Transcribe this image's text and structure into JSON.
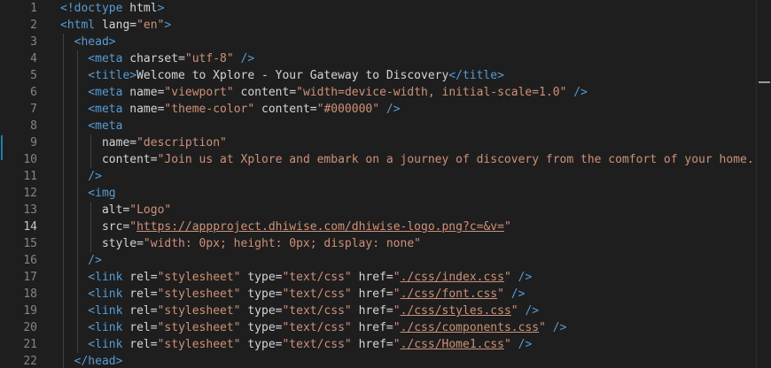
{
  "editor": {
    "active_line": 14,
    "lines": [
      {
        "n": "1",
        "tokens": [
          [
            "tag",
            "<!doctype "
          ],
          [
            "plain",
            "html"
          ],
          [
            "tag",
            ">"
          ]
        ]
      },
      {
        "n": "2",
        "tokens": [
          [
            "tag",
            "<html "
          ],
          [
            "attr",
            "lang"
          ],
          [
            "plain",
            "="
          ],
          [
            "str",
            "\"en\""
          ],
          [
            "tag",
            ">"
          ]
        ]
      },
      {
        "n": "3",
        "tokens": [
          [
            "tag",
            "  <head>"
          ]
        ]
      },
      {
        "n": "4",
        "tokens": [
          [
            "tag",
            "    <meta "
          ],
          [
            "attr",
            "charset"
          ],
          [
            "plain",
            "="
          ],
          [
            "str",
            "\"utf-8\""
          ],
          [
            "tag",
            " />"
          ]
        ]
      },
      {
        "n": "5",
        "tokens": [
          [
            "tag",
            "    <title>"
          ],
          [
            "text",
            "Welcome to Xplore - Your Gateway to Discovery"
          ],
          [
            "tag",
            "</title>"
          ]
        ]
      },
      {
        "n": "6",
        "tokens": [
          [
            "tag",
            "    <meta "
          ],
          [
            "attr",
            "name"
          ],
          [
            "plain",
            "="
          ],
          [
            "str",
            "\"viewport\""
          ],
          [
            "attr",
            " content"
          ],
          [
            "plain",
            "="
          ],
          [
            "str",
            "\"width=device-width, initial-scale=1.0\""
          ],
          [
            "tag",
            " />"
          ]
        ]
      },
      {
        "n": "7",
        "tokens": [
          [
            "tag",
            "    <meta "
          ],
          [
            "attr",
            "name"
          ],
          [
            "plain",
            "="
          ],
          [
            "str",
            "\"theme-color\""
          ],
          [
            "attr",
            " content"
          ],
          [
            "plain",
            "="
          ],
          [
            "str",
            "\"#000000\""
          ],
          [
            "tag",
            " />"
          ]
        ]
      },
      {
        "n": "8",
        "tokens": [
          [
            "tag",
            "    <meta"
          ]
        ]
      },
      {
        "n": "9",
        "tokens": [
          [
            "attr",
            "      name"
          ],
          [
            "plain",
            "="
          ],
          [
            "str",
            "\"description\""
          ]
        ]
      },
      {
        "n": "10",
        "tokens": [
          [
            "attr",
            "      content"
          ],
          [
            "plain",
            "="
          ],
          [
            "str",
            "\"Join us at Xplore and embark on a journey of discovery from the comfort of your home. Exp"
          ]
        ]
      },
      {
        "n": "11",
        "tokens": [
          [
            "tag",
            "    />"
          ]
        ]
      },
      {
        "n": "12",
        "tokens": [
          [
            "tag",
            "    <img"
          ]
        ]
      },
      {
        "n": "13",
        "tokens": [
          [
            "attr",
            "      alt"
          ],
          [
            "plain",
            "="
          ],
          [
            "str",
            "\"Logo\""
          ]
        ]
      },
      {
        "n": "14",
        "tokens": [
          [
            "attr",
            "      src"
          ],
          [
            "plain",
            "="
          ],
          [
            "str",
            "\""
          ],
          [
            "str-link",
            "https://appproject.dhiwise.com/dhiwise-logo.png?c=&v="
          ],
          [
            "str",
            "\""
          ]
        ]
      },
      {
        "n": "15",
        "tokens": [
          [
            "attr",
            "      style"
          ],
          [
            "plain",
            "="
          ],
          [
            "str",
            "\"width: 0px; height: 0px; display: none\""
          ]
        ]
      },
      {
        "n": "16",
        "tokens": [
          [
            "tag",
            "    />"
          ]
        ]
      },
      {
        "n": "17",
        "tokens": [
          [
            "tag",
            "    <link "
          ],
          [
            "attr",
            "rel"
          ],
          [
            "plain",
            "="
          ],
          [
            "str",
            "\"stylesheet\""
          ],
          [
            "attr",
            " type"
          ],
          [
            "plain",
            "="
          ],
          [
            "str",
            "\"text/css\""
          ],
          [
            "attr",
            " href"
          ],
          [
            "plain",
            "="
          ],
          [
            "str",
            "\""
          ],
          [
            "str-link",
            "./css/index.css"
          ],
          [
            "str",
            "\""
          ],
          [
            "tag",
            " />"
          ]
        ]
      },
      {
        "n": "18",
        "tokens": [
          [
            "tag",
            "    <link "
          ],
          [
            "attr",
            "rel"
          ],
          [
            "plain",
            "="
          ],
          [
            "str",
            "\"stylesheet\""
          ],
          [
            "attr",
            " type"
          ],
          [
            "plain",
            "="
          ],
          [
            "str",
            "\"text/css\""
          ],
          [
            "attr",
            " href"
          ],
          [
            "plain",
            "="
          ],
          [
            "str",
            "\""
          ],
          [
            "str-link",
            "./css/font.css"
          ],
          [
            "str",
            "\""
          ],
          [
            "tag",
            " />"
          ]
        ]
      },
      {
        "n": "19",
        "tokens": [
          [
            "tag",
            "    <link "
          ],
          [
            "attr",
            "rel"
          ],
          [
            "plain",
            "="
          ],
          [
            "str",
            "\"stylesheet\""
          ],
          [
            "attr",
            " type"
          ],
          [
            "plain",
            "="
          ],
          [
            "str",
            "\"text/css\""
          ],
          [
            "attr",
            " href"
          ],
          [
            "plain",
            "="
          ],
          [
            "str",
            "\""
          ],
          [
            "str-link",
            "./css/styles.css"
          ],
          [
            "str",
            "\""
          ],
          [
            "tag",
            " />"
          ]
        ]
      },
      {
        "n": "20",
        "tokens": [
          [
            "tag",
            "    <link "
          ],
          [
            "attr",
            "rel"
          ],
          [
            "plain",
            "="
          ],
          [
            "str",
            "\"stylesheet\""
          ],
          [
            "attr",
            " type"
          ],
          [
            "plain",
            "="
          ],
          [
            "str",
            "\"text/css\""
          ],
          [
            "attr",
            " href"
          ],
          [
            "plain",
            "="
          ],
          [
            "str",
            "\""
          ],
          [
            "str-link",
            "./css/components.css"
          ],
          [
            "str",
            "\""
          ],
          [
            "tag",
            " />"
          ]
        ]
      },
      {
        "n": "21",
        "tokens": [
          [
            "tag",
            "    <link "
          ],
          [
            "attr",
            "rel"
          ],
          [
            "plain",
            "="
          ],
          [
            "str",
            "\"stylesheet\""
          ],
          [
            "attr",
            " type"
          ],
          [
            "plain",
            "="
          ],
          [
            "str",
            "\"text/css\""
          ],
          [
            "attr",
            " href"
          ],
          [
            "plain",
            "="
          ],
          [
            "str",
            "\""
          ],
          [
            "str-link",
            "./css/Home1.css"
          ],
          [
            "str",
            "\""
          ],
          [
            "tag",
            " />"
          ]
        ]
      },
      {
        "n": "22",
        "tokens": [
          [
            "tag",
            "  </head>"
          ]
        ]
      }
    ]
  },
  "colors": {
    "background": "#1e1e1e",
    "tag": "#569cd6",
    "attribute": "#d4d4d4",
    "string": "#ce9178",
    "line_number": "#858585"
  }
}
